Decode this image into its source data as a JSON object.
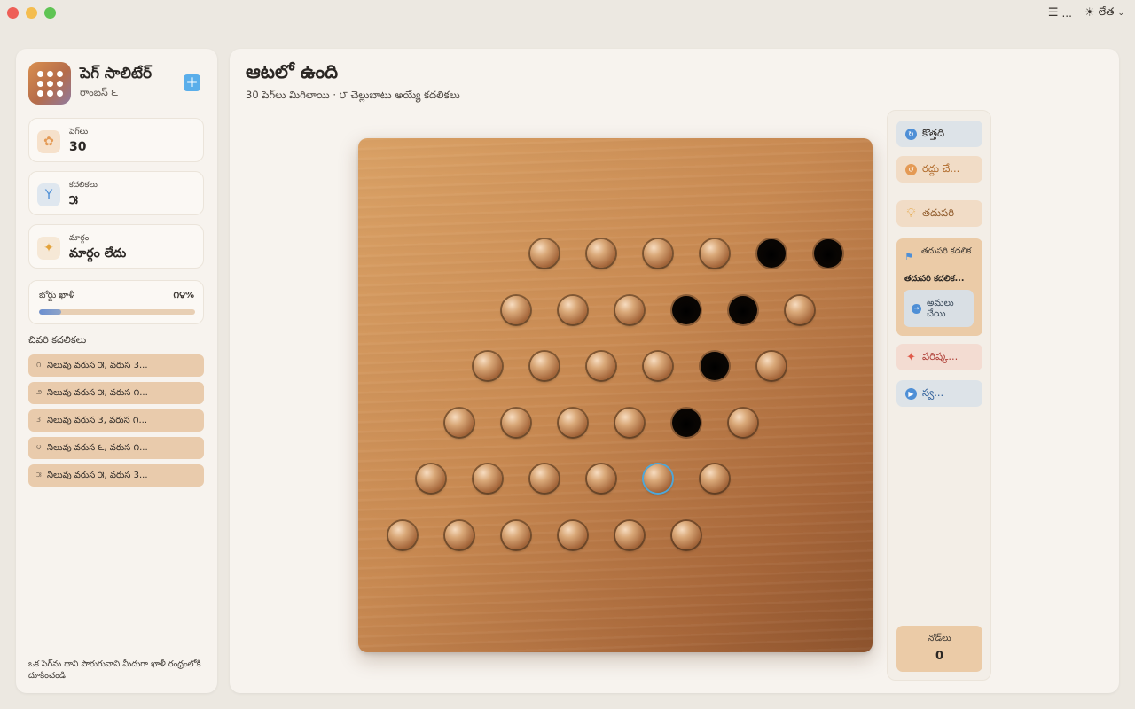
{
  "titlebar": {
    "menu_label": "...",
    "theme_label": "లేత"
  },
  "sidebar": {
    "app_title": "పెగ్ సాలిటేర్",
    "app_subtitle": "రాంబస్ ౬",
    "add_label": "+",
    "stats": [
      {
        "label": "పెగ్‌లు",
        "value": "30",
        "icon": "pegs-icon",
        "icon_color": "#e49a55",
        "icon_bg": "#f6e1cb"
      },
      {
        "label": "కదలికలు",
        "value": "౫",
        "icon": "branch-icon",
        "icon_color": "#4e8fd6",
        "icon_bg": "#dfe7ef"
      },
      {
        "label": "మార్గం",
        "value": "మార్గం లేదు",
        "icon": "sparkle-icon",
        "icon_color": "#e3a23a",
        "icon_bg": "#f6e8d6"
      }
    ],
    "progress": {
      "label": "బోర్డు ఖాళీ",
      "value_text": "౧౪%",
      "fraction": 0.14
    },
    "recent_heading": "చివరి కదలికలు",
    "recent_moves": [
      {
        "num": "౧",
        "text": "నిలువు వరుస ౫, వరుస 3..."
      },
      {
        "num": "౨",
        "text": "నిలువు వరుస ౫, వరుస ౧..."
      },
      {
        "num": "3",
        "text": "నిలువు వరుస 3, వరుస ౧..."
      },
      {
        "num": "౪",
        "text": "నిలువు వరుస ౬, వరుస ౧..."
      },
      {
        "num": "౫",
        "text": "నిలువు వరుస ౫, వరుస 3..."
      }
    ],
    "hint": "ఒక పెగ్‌ను దాని పొరుగువాని మీదుగా ఖాళీ రంధ్రంలోకి దూకించండి."
  },
  "main": {
    "title": "ఆటలో ఉంది",
    "subtitle": "30 పెగ్‌లు మిగిలాయి · ౮ చెల్లుబాటు అయ్యే కదలికలు"
  },
  "board": {
    "rows": [
      "PPPPEE",
      "PPPEEP",
      "PPPPEP",
      "PPPPEP",
      "PPPPSP",
      "PPPPPP"
    ],
    "legend": {
      "P": "peg",
      "E": "empty",
      "S": "selected-peg"
    }
  },
  "panel": {
    "new_label": "కొత్తది",
    "undo_label": "రద్దు చే...",
    "hint_label": "తదుపరి",
    "next_label": "తదుపరి కదలిక",
    "next_move": "తదుపరి కదలిక...",
    "apply_label": "అమలు చేయి",
    "solve_label": "పరిష్క...",
    "auto_label": "స్వ...",
    "nodes_label": "నోడ్‌లు",
    "nodes_value": "0"
  }
}
